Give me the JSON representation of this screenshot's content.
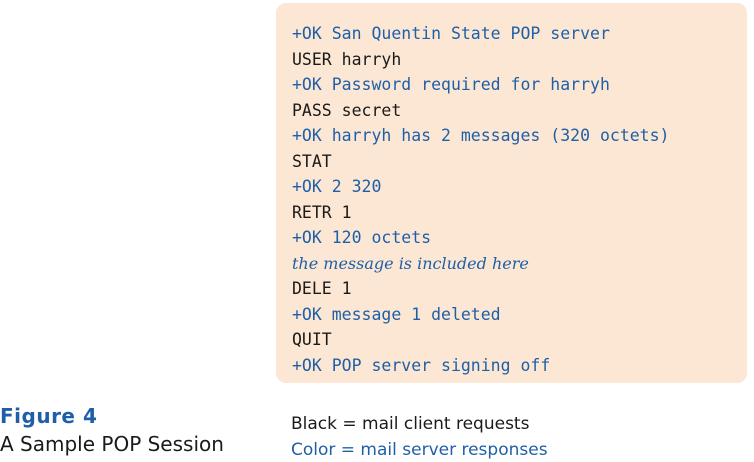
{
  "session": {
    "lines": [
      {
        "speaker": "server",
        "text": "+OK San Quentin State POP server"
      },
      {
        "speaker": "client",
        "text": "USER harryh"
      },
      {
        "speaker": "server",
        "text": "+OK Password required for harryh"
      },
      {
        "speaker": "client",
        "text": "PASS secret"
      },
      {
        "speaker": "server",
        "text": "+OK harryh has 2 messages (320 octets)"
      },
      {
        "speaker": "client",
        "text": "STAT"
      },
      {
        "speaker": "server",
        "text": "+OK 2 320"
      },
      {
        "speaker": "client",
        "text": "RETR 1"
      },
      {
        "speaker": "server",
        "text": "+OK 120 octets"
      },
      {
        "speaker": "note",
        "text": "the message is included here"
      },
      {
        "speaker": "client",
        "text": "DELE 1"
      },
      {
        "speaker": "server",
        "text": "+OK message 1 deleted"
      },
      {
        "speaker": "client",
        "text": "QUIT"
      },
      {
        "speaker": "server",
        "text": "+OK POP server signing off"
      }
    ]
  },
  "figure": {
    "label": "Figure 4",
    "caption": "A Sample POP Session"
  },
  "legend": {
    "black": "Black = mail client requests",
    "color": "Color = mail server responses"
  },
  "colors": {
    "server_text": "#1f5fa8",
    "client_text": "#1a1a1a",
    "box_background": "#fbe7d3"
  }
}
